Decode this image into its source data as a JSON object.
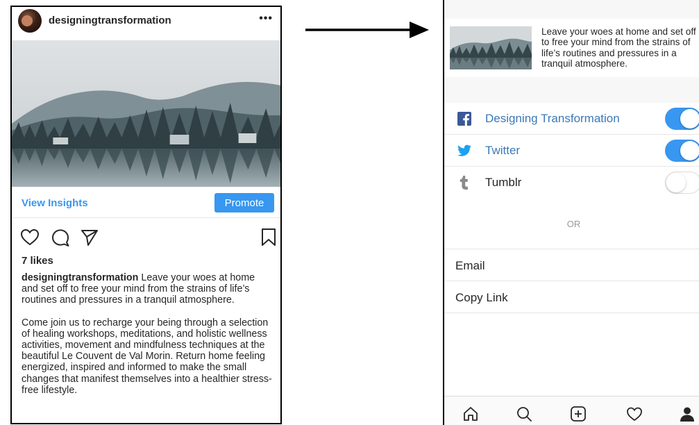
{
  "post": {
    "username": "designingtransformation",
    "view_insights_label": "View Insights",
    "promote_label": "Promote",
    "likes": "7 likes",
    "caption_username": "designingtransformation",
    "caption_text": " Leave your woes at home and set off to free your mind from the strains of life’s routines and pressures in a tranquil atmosphere.",
    "caption_second": "Come join us to recharge your being through a selection of healing workshops, meditations, and holistic wellness activities, movement and mindfulness techniques at the beautiful Le Couvent de Val Morin. Return home feeling energized, inspired and informed to make the small changes that manifest themselves into a healthier stress-free lifestyle."
  },
  "share_sheet": {
    "preview_text": "Leave your woes at home and set off to free your mind from the strains of life’s routines and pressures in a tranquil atmosphere.",
    "rows": [
      {
        "label": "Designing Transformation",
        "icon": "facebook-icon",
        "enabled": true
      },
      {
        "label": "Twitter",
        "icon": "twitter-icon",
        "enabled": true
      },
      {
        "label": "Tumblr",
        "icon": "tumblr-icon",
        "enabled": false
      }
    ],
    "or_label": "OR",
    "email_label": "Email",
    "copy_link_label": "Copy Link"
  },
  "tabs": [
    "home-icon",
    "search-icon",
    "add-post-icon",
    "activity-heart-icon",
    "profile-icon"
  ],
  "colors": {
    "accent": "#3897f0",
    "facebook": "#3b5998",
    "twitter": "#1da1f2",
    "tumblr": "#8a8a8a",
    "text": "#262626",
    "notification_dot": "#ed4956"
  }
}
